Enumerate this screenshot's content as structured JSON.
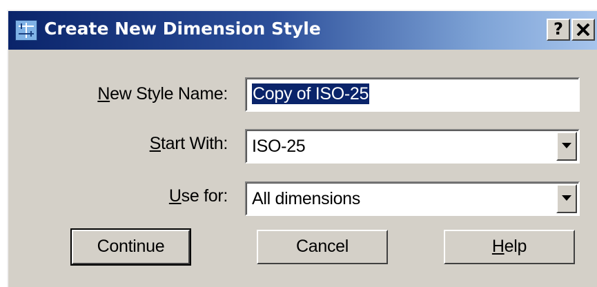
{
  "dialog": {
    "title": "Create New Dimension Style",
    "help_button": "?"
  },
  "fields": {
    "new_style_name": {
      "label_accel": "N",
      "label_rest": "ew Style Name:",
      "value": "Copy of ISO-25"
    },
    "start_with": {
      "label_accel": "S",
      "label_rest": "tart With:",
      "value": "ISO-25"
    },
    "use_for": {
      "label_accel": "U",
      "label_rest": "se for:",
      "value": "All dimensions"
    }
  },
  "buttons": {
    "continue": "Continue",
    "cancel": "Cancel",
    "help_accel": "H",
    "help_rest": "elp"
  },
  "icons": {
    "app": "dimension-style-icon",
    "close": "close-icon",
    "dropdown": "dropdown-arrow-icon"
  },
  "colors": {
    "titlebar_start": "#0a246a",
    "titlebar_end": "#a6c4ec",
    "dialog_face": "#d4d0c8",
    "selection": "#0a246a"
  }
}
